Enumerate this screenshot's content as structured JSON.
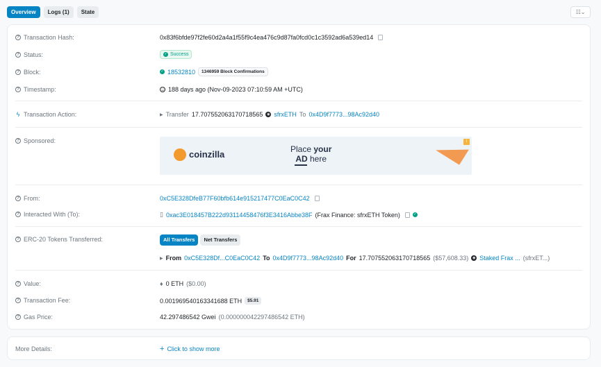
{
  "tabs": [
    {
      "label": "Overview"
    },
    {
      "label": "Logs (1)"
    },
    {
      "label": "State"
    }
  ],
  "view_toggle": {
    "icon": "list-view-icon",
    "glyph": "☷⌄"
  },
  "rows": {
    "tx_hash": {
      "label": "Transaction Hash:",
      "value": "0x83f6bfde97f2fe60d2a4a1f55f9c4ea476c9d87fa0fcd0c1c3592ad6a539ed14"
    },
    "status": {
      "label": "Status:",
      "value": "Success"
    },
    "block": {
      "label": "Block:",
      "value": "18532810",
      "confirmations": "1346959 Block Confirmations"
    },
    "timestamp": {
      "label": "Timestamp:",
      "value": "188 days ago (Nov-09-2023 07:10:59 AM +UTC)"
    },
    "action": {
      "label": "Transaction Action:",
      "prefix": "Transfer",
      "amount": "17.707552063170718565",
      "token": "sfrxETH",
      "to_word": "To",
      "to_address": "0x4D9f7773...98Ac92d40"
    },
    "sponsored": {
      "label": "Sponsored:",
      "ad_brand": "coinzilla",
      "ad_line1_a": "Place ",
      "ad_line1_b": "your",
      "ad_line2_a": "AD",
      "ad_line2_b": " here"
    },
    "from": {
      "label": "From:",
      "value": "0xC5E328DfeB77F60bfb614e915217477C0EaC0C42"
    },
    "interacted": {
      "label": "Interacted With (To):",
      "address": "0xac3E018457B222d93114458476f3E3416Abbe38F",
      "name": "(Frax Finance: sfrxETH Token)"
    },
    "erc20": {
      "label": "ERC-20 Tokens Transferred:",
      "tab_all": "All Transfers",
      "tab_net": "Net Transfers",
      "from_word": "From",
      "from_address": "0xC5E328Df...C0EaC0C42",
      "to_word": "To",
      "to_address": "0x4D9f7773...98Ac92d40",
      "for_word": "For",
      "amount": "17.707552063170718565",
      "usd": "($57,608.33)",
      "token_name": "Staked Frax ...",
      "token_symbol": "(sfrxET...)"
    },
    "value": {
      "label": "Value:",
      "value": "0 ETH",
      "usd": "($0.00)"
    },
    "fee": {
      "label": "Transaction Fee:",
      "value": "0.001969540163341688 ETH",
      "usd": "$5.91"
    },
    "gas": {
      "label": "Gas Price:",
      "value": "42.297486542 Gwei",
      "eth": "(0.000000042297486542 ETH)"
    }
  },
  "more": {
    "label": "More Details:",
    "action": "Click to show more"
  }
}
